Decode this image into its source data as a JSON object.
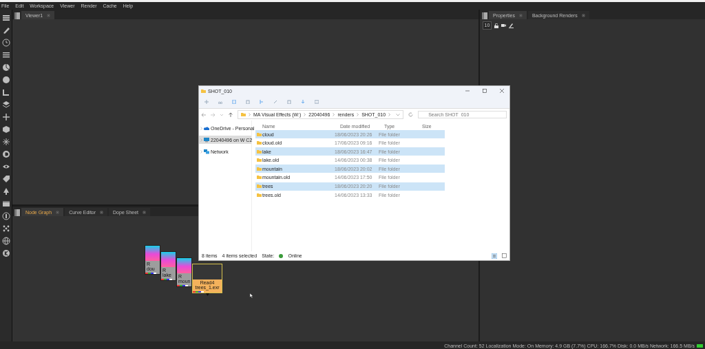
{
  "menu": [
    "File",
    "Edit",
    "Workspace",
    "Viewer",
    "Render",
    "Cache",
    "Help"
  ],
  "viewer": {
    "tabs": [
      {
        "label": "Viewer1",
        "selected": true
      }
    ]
  },
  "properties": {
    "tabs": [
      {
        "label": "Properties",
        "selected": true
      },
      {
        "label": "Background Renders",
        "selected": false
      }
    ],
    "frame_field": "10"
  },
  "node_graph": {
    "tabs": [
      {
        "label": "Node Graph",
        "selected": true
      },
      {
        "label": "Curve Editor",
        "selected": false
      },
      {
        "label": "Dope Sheet",
        "selected": false
      }
    ],
    "nodes": [
      {
        "title": "R",
        "file": "dou",
        "selected": false
      },
      {
        "title": "R",
        "file": "lake",
        "selected": false
      },
      {
        "title": "R",
        "file": "moun",
        "selected": false
      },
      {
        "title": "Read4",
        "file": "trees_1.exr",
        "selected": true
      }
    ]
  },
  "explorer": {
    "title": "SHOT_010",
    "breadcrumbs": [
      "MA Visual Effects (W:)",
      "22040496",
      "renders",
      "SHOT_010"
    ],
    "search": {
      "placeholder": "Search SHOT_010"
    },
    "nav": [
      {
        "label": "OneDrive - Personal",
        "kind": "cloud",
        "selected": false
      },
      {
        "label": "22040496 on W C2",
        "kind": "computer",
        "selected": true
      },
      {
        "label": "Network",
        "kind": "network",
        "selected": false
      }
    ],
    "columns": [
      "Name",
      "Date modified",
      "Type",
      "Size"
    ],
    "rows": [
      {
        "name": "cloud",
        "date": "18/06/2023 20:26",
        "type": "File folder",
        "selected": true
      },
      {
        "name": "cloud.old",
        "date": "17/06/2023 09:16",
        "type": "File folder",
        "selected": false
      },
      {
        "name": "lake",
        "date": "18/06/2023 16:47",
        "type": "File folder",
        "selected": true
      },
      {
        "name": "lake.old",
        "date": "14/06/2023 00:38",
        "type": "File folder",
        "selected": false
      },
      {
        "name": "mountain",
        "date": "18/06/2023 20:02",
        "type": "File folder",
        "selected": true
      },
      {
        "name": "mountain.old",
        "date": "14/06/2023 17:50",
        "type": "File folder",
        "selected": false
      },
      {
        "name": "trees",
        "date": "18/06/2023 20:20",
        "type": "File folder",
        "selected": true
      },
      {
        "name": "trees.old",
        "date": "14/06/2023 13:33",
        "type": "File folder",
        "selected": false
      }
    ],
    "status": {
      "count": "8 items",
      "selected_count": "4 items selected",
      "state_label": "State:",
      "state": "Online"
    }
  },
  "status_bar": "Channel Count: 52  Localization Mode: On  Memory: 4.9 GB (7.7%)  CPU: 166.7%  Disk: 0.0 MB/s  Network: 166.5 MB/s"
}
